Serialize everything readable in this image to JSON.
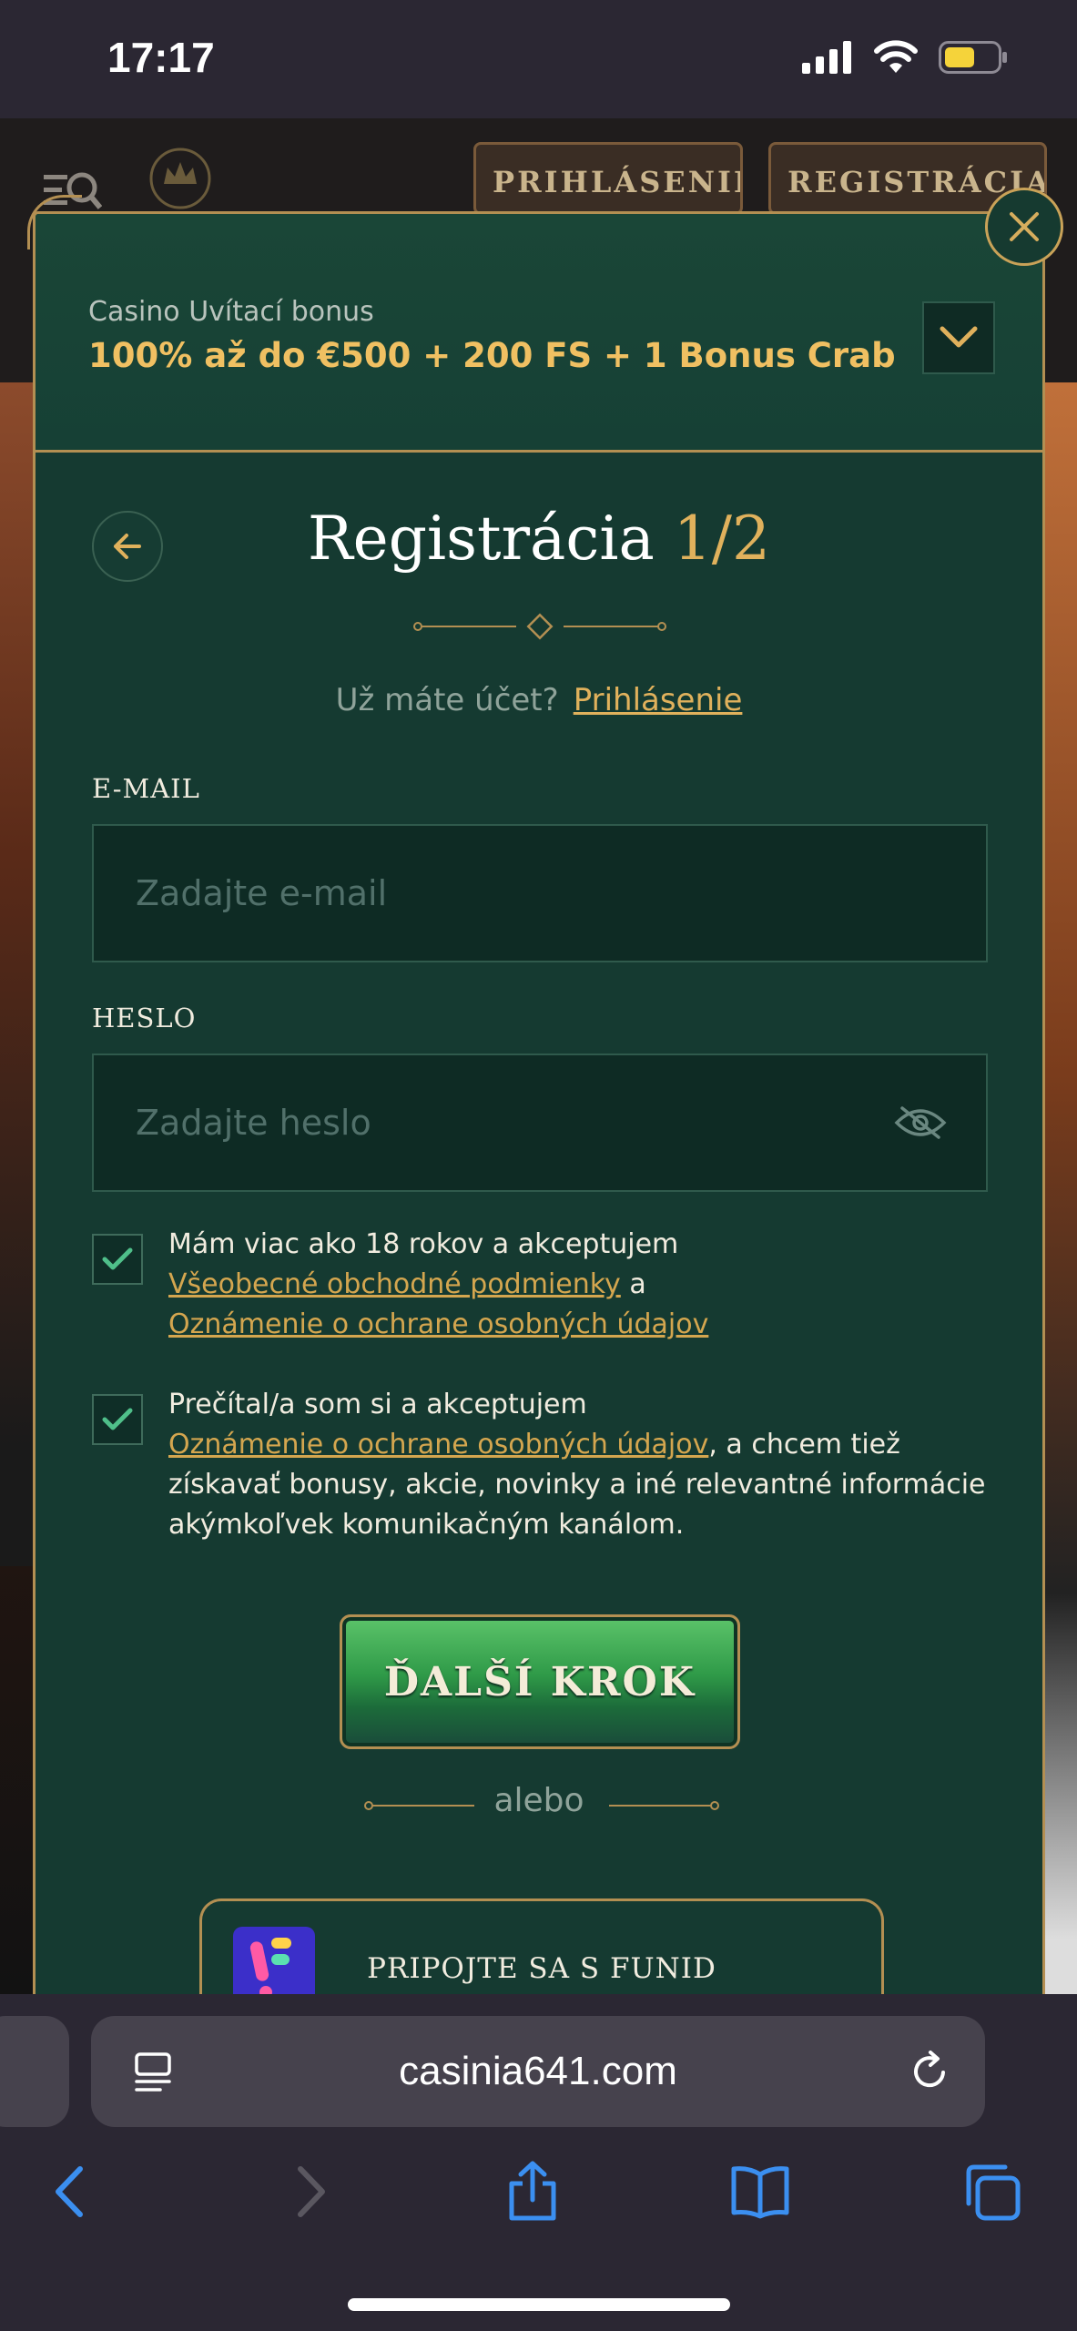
{
  "status_bar": {
    "time": "17:17"
  },
  "site": {
    "login_label": "PRIHLÁSENIE",
    "register_label": "REGISTRÁCIA"
  },
  "bonus": {
    "subtitle": "Casino Uvítací bonus",
    "title": "100% až do €500 + 200 FS + 1 Bonus Crab"
  },
  "registration": {
    "title": "Registrácia",
    "step": "1/2",
    "have_account": "Už máte účet?",
    "login_link": "Prihlásenie",
    "email_label": "E-MAIL",
    "email_placeholder": "Zadajte e-mail",
    "password_label": "HESLO",
    "password_placeholder": "Zadajte heslo",
    "consent_1": {
      "checked": true,
      "text_a": "Mám viac ako 18 rokov a akceptujem",
      "link_terms": "Všeobecné obchodné podmienky",
      "text_b": "a",
      "link_privacy": "Oznámenie o ochrane osobných údajov"
    },
    "consent_2": {
      "checked": true,
      "text_a": "Prečítal/a som si a akceptujem",
      "link_privacy": "Oznámenie o ochrane osobných údajov",
      "text_b": ", a chcem tiež získavať bonusy, akcie, novinky a iné relevantné informácie akýmkoľvek komunikačným kanálom."
    },
    "next_button": "ĎALŠÍ KROK",
    "or_text": "alebo",
    "funid_button": "PRIPOJTE SA S FUNID"
  },
  "browser": {
    "url": "casinia641.com"
  },
  "colors": {
    "modal_bg": "#153a31",
    "gold": "#e0b15c",
    "border_gold": "#b38f52",
    "field_bg": "#0e2b24",
    "check_green": "#4fbf8a"
  }
}
